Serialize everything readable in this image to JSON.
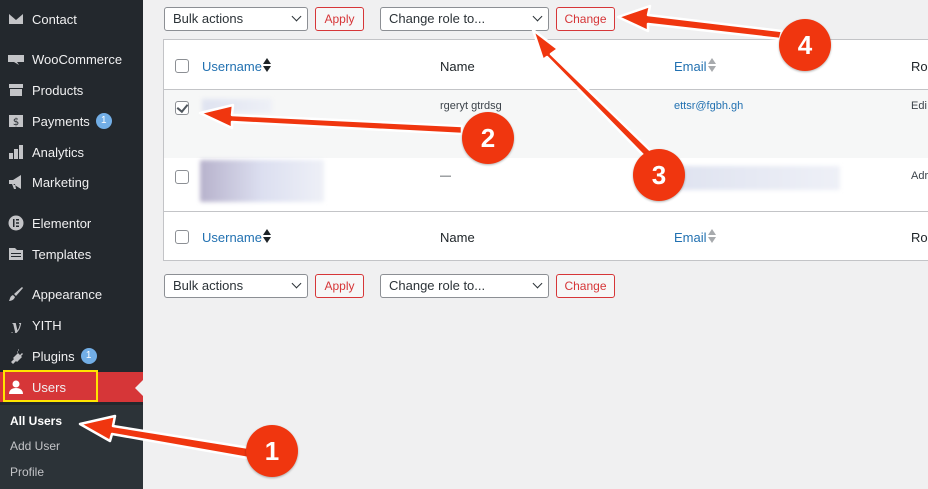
{
  "sidebar": {
    "items": [
      {
        "label": "Contact",
        "icon": "envelope-icon"
      },
      {
        "label": "WooCommerce",
        "icon": "woocommerce-icon"
      },
      {
        "label": "Products",
        "icon": "archive-icon"
      },
      {
        "label": "Payments",
        "icon": "dollar-icon",
        "badge": "1"
      },
      {
        "label": "Analytics",
        "icon": "bar-chart-icon"
      },
      {
        "label": "Marketing",
        "icon": "megaphone-icon"
      },
      {
        "label": "Elementor",
        "icon": "elementor-icon"
      },
      {
        "label": "Templates",
        "icon": "folder-icon"
      },
      {
        "label": "Appearance",
        "icon": "paintbrush-icon"
      },
      {
        "label": "YITH",
        "icon": "yith-icon"
      },
      {
        "label": "Plugins",
        "icon": "plug-icon",
        "badge": "1"
      },
      {
        "label": "Users",
        "icon": "user-icon"
      }
    ],
    "submenu": [
      "All Users",
      "Add User",
      "Profile"
    ]
  },
  "controls": {
    "bulk_actions": "Bulk actions",
    "apply": "Apply",
    "change_role": "Change role to...",
    "change": "Change"
  },
  "table": {
    "columns": [
      "Username",
      "Name",
      "Email",
      "Rol"
    ],
    "rows": [
      {
        "username": "",
        "name": "rgeryt gtrdsg",
        "email": "ettsr@fgbh.gh",
        "role": "Edi",
        "checked": true
      },
      {
        "username": "",
        "name": "—",
        "email": "",
        "role": "Adr",
        "checked": false
      }
    ]
  },
  "annotations": [
    "1",
    "2",
    "3",
    "4"
  ],
  "colors": {
    "accent": "#d63638",
    "link": "#2271b1",
    "sidebar": "#23282d",
    "annotation": "#f0360f",
    "highlight": "#ffe500"
  }
}
